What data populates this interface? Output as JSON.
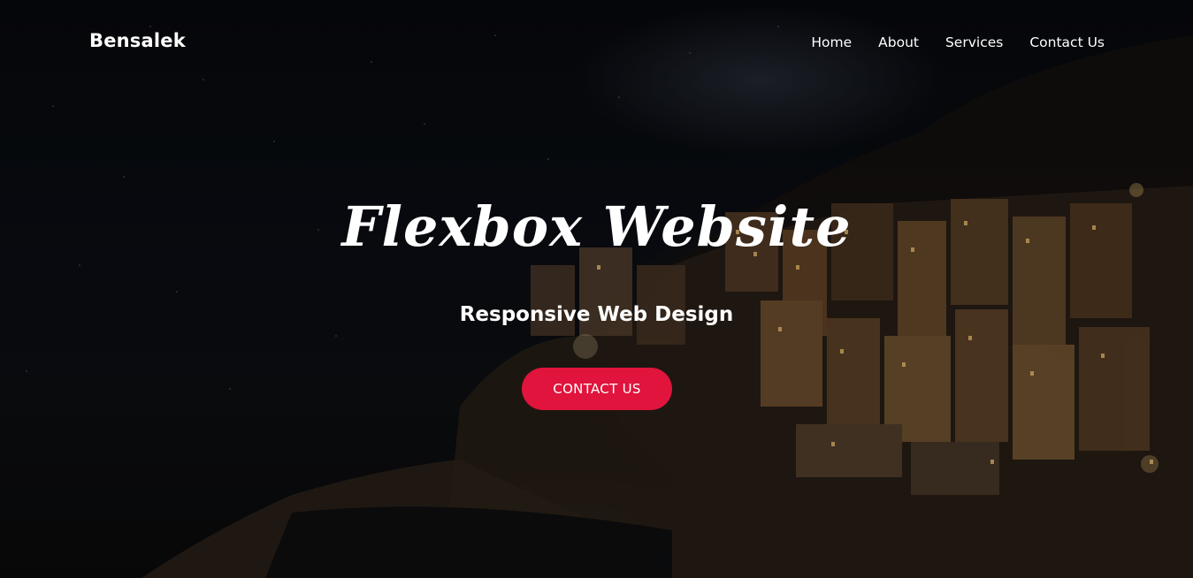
{
  "brand": {
    "logo_text": "Bensalek"
  },
  "nav": {
    "items": [
      {
        "label": "Home"
      },
      {
        "label": "About"
      },
      {
        "label": "Services"
      },
      {
        "label": "Contact Us"
      }
    ]
  },
  "hero": {
    "title": "Flexbox Website",
    "subtitle": "Responsive Web Design",
    "cta_label": "CONTACT US"
  },
  "colors": {
    "accent": "#e0143c",
    "text": "#ffffff",
    "background": "#07090e"
  }
}
